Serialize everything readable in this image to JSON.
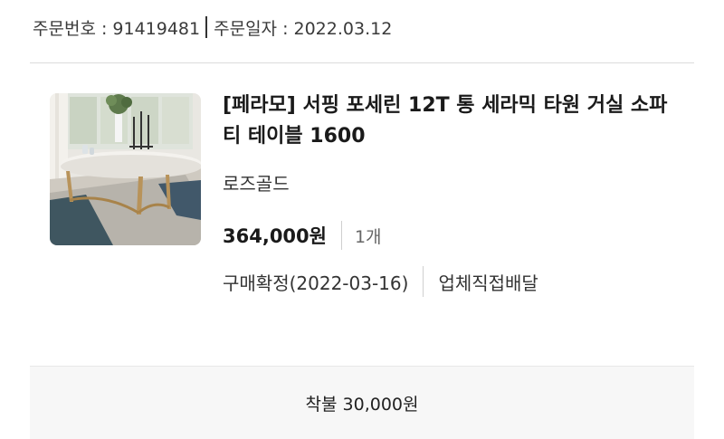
{
  "order": {
    "number_label": "주문번호 : 91419481",
    "date_label": "주문일자 : 2022.03.12"
  },
  "product": {
    "image_name": "marble-oval-coffee-table",
    "title": "[페라모] 서핑 포세린 12T 통 세라믹 타원 거실 소파 티 테이블 1600",
    "option": "로즈골드",
    "price": "364,000원",
    "quantity": "1개",
    "status": "구매확정(2022-03-16)",
    "delivery": "업체직접배달"
  },
  "shipping": {
    "text": "착불 30,000원"
  },
  "colors": {
    "divider": "#dcdcdc",
    "shipping_bg": "#f7f7f7",
    "text_dark": "#1a1a1a",
    "text_muted": "#666666"
  }
}
